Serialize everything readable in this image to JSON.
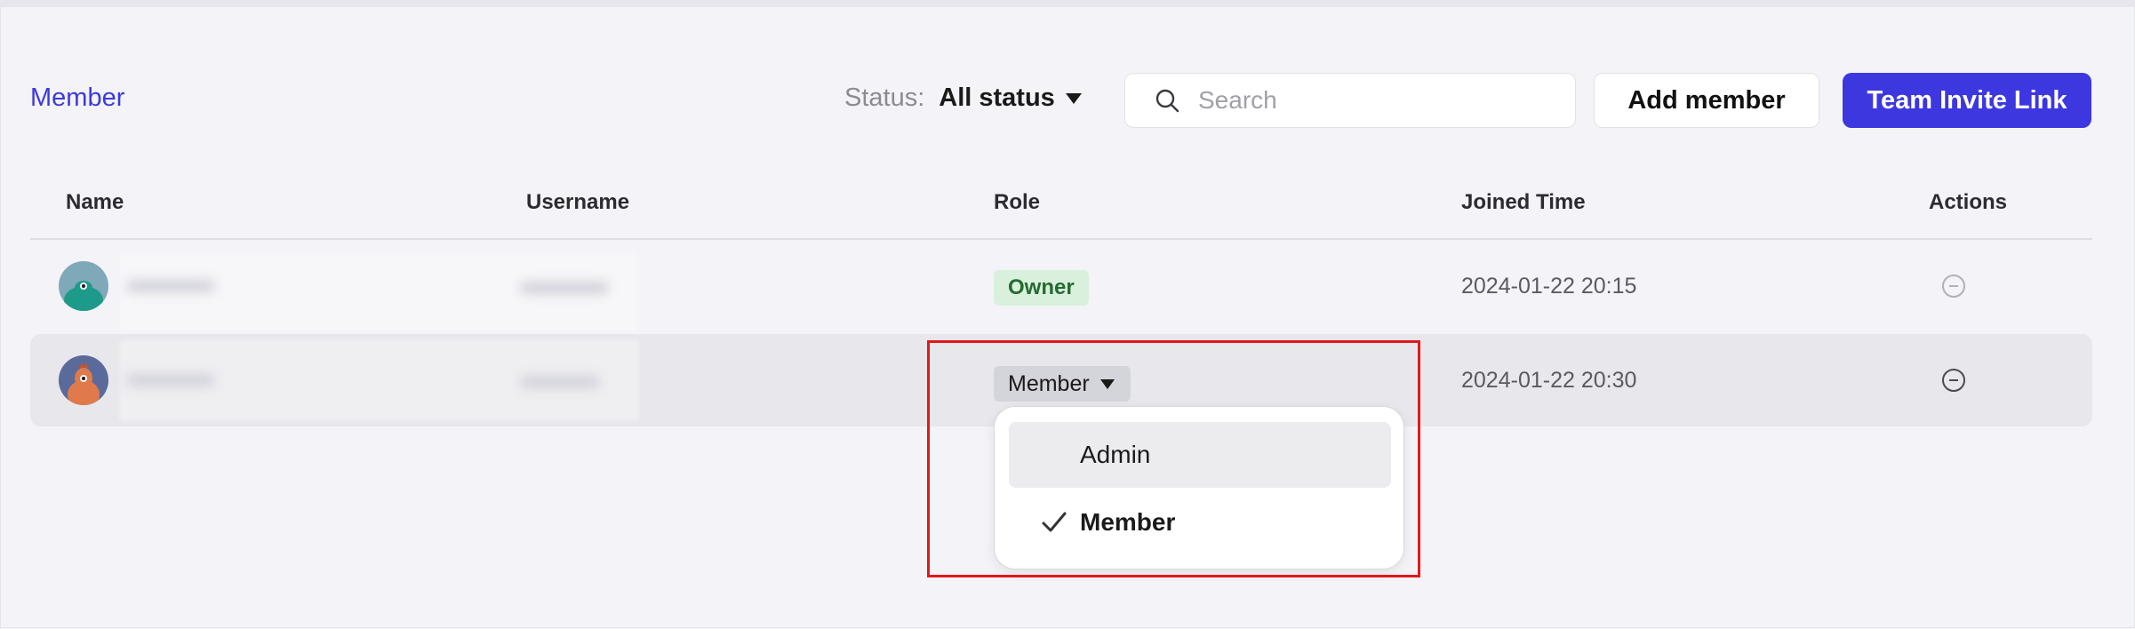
{
  "section": {
    "title": "Member"
  },
  "filters": {
    "status_label": "Status:",
    "status_value": "All status",
    "search_placeholder": "Search"
  },
  "buttons": {
    "add_member": "Add member",
    "team_invite_link": "Team Invite Link"
  },
  "table": {
    "columns": [
      "Name",
      "Username",
      "Role",
      "Joined Time",
      "Actions"
    ],
    "rows": [
      {
        "role": "Owner",
        "joined": "2024-01-22 20:15",
        "action_icon": "minus-circle-icon"
      },
      {
        "role": "Member",
        "joined": "2024-01-22 20:30",
        "action_icon": "minus-circle-icon"
      }
    ]
  },
  "role_dropdown": {
    "options": [
      {
        "label": "Admin",
        "selected": false
      },
      {
        "label": "Member",
        "selected": true
      }
    ]
  },
  "colors": {
    "accent": "#3d37e0",
    "owner_badge_bg": "#d9f1dc",
    "highlight_box": "#e0191c"
  }
}
